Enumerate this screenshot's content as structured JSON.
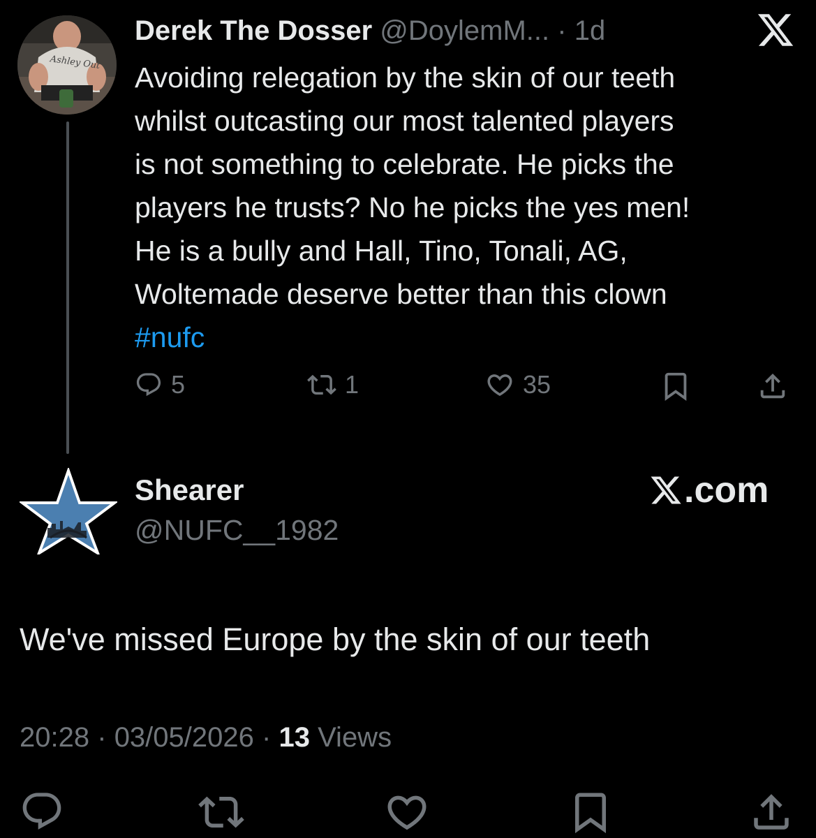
{
  "parent_tweet": {
    "author": {
      "display_name": "Derek The Dosser",
      "handle": "@DoylemM...",
      "avatar_shirt_text": "Ashley Out"
    },
    "separator": "·",
    "time": "1d",
    "text_main": "Avoiding relegation by the skin of our teeth\nwhilst outcasting our most talented players\nis not something to celebrate. He picks the\nplayers he trusts? No he picks the yes men!\nHe is a bully and Hall, Tino, Tonali, AG,\nWoltemade deserve better than this clown\n",
    "hashtag": "#nufc",
    "stats": {
      "replies": "5",
      "retweets": "1",
      "likes": "35"
    },
    "icons": [
      "x-logo-icon",
      "reply-icon",
      "retweet-icon",
      "like-icon",
      "bookmark-icon",
      "share-icon"
    ]
  },
  "focused_tweet": {
    "author": {
      "display_name": "Shearer",
      "handle": "@NUFC__1982"
    },
    "brand_label": ".com",
    "text": "We've missed Europe by the skin of our teeth",
    "meta": {
      "time": "20:28",
      "date": "03/05/2026",
      "separator": "·",
      "views_count": "13",
      "views_label": "Views"
    },
    "icons": [
      "reply-icon",
      "retweet-icon",
      "like-icon",
      "bookmark-icon",
      "share-icon"
    ]
  },
  "colors": {
    "background": "#000000",
    "text_primary": "#e7e9ea",
    "text_secondary": "#71767b",
    "link": "#1d9bf0",
    "thread_line": "#4a4f54"
  }
}
